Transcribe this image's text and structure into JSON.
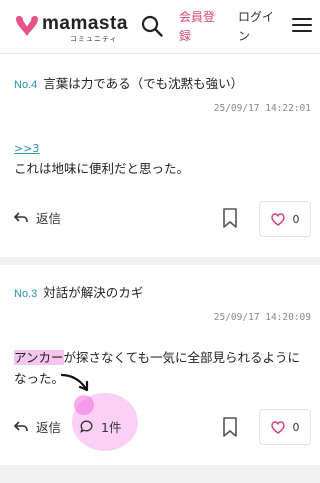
{
  "header": {
    "logo_text": "mamasta",
    "logo_sub": "コミュニティ",
    "register": "会員登録",
    "login": "ログイン"
  },
  "posts": [
    {
      "no": "No.4",
      "title": "言葉は力である（でも沈黙も強い）",
      "time": "25/09/17 14:22:01",
      "anchor": ">>3",
      "body": "これは地味に便利だと思った。",
      "reply_label": "返信",
      "like_count": "0"
    },
    {
      "no": "No.3",
      "title": "対話が解決のカギ",
      "time": "25/09/17 14:20:09",
      "body_highlight": "アンカー",
      "body_rest": "が探さなくても一気に全部見られるようになった。",
      "reply_label": "返信",
      "comment_count": "1件",
      "like_count": "0"
    }
  ],
  "colors": {
    "accent_pink": "#d9457a",
    "link_blue": "#2a8fb0",
    "highlight": "#f6c6ee"
  }
}
